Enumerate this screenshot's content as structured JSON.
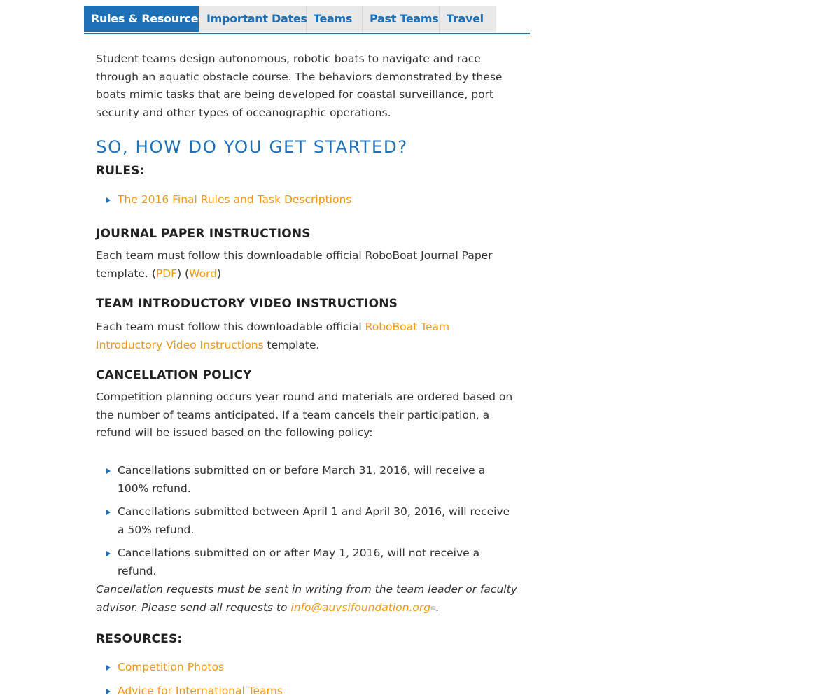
{
  "tabs": {
    "rules": "Rules & Resources",
    "dates": "Important Dates",
    "teams": "Teams",
    "past": "Past Teams",
    "travel": "Travel"
  },
  "intro": "Student teams design autonomous, robotic boats to navigate and race through an aquatic obstacle course. The behaviors demonstrated by these boats mimic tasks that are being developed for coastal surveillance, port security and other types of oceanographic operations.",
  "main_heading": "So, how do you get started?",
  "rules": {
    "heading": "Rules:",
    "link": "The 2016 Final Rules and Task Descriptions"
  },
  "journal": {
    "heading": "Journal Paper Instructions",
    "text_before": "Each team must follow this downloadable official RoboBoat Journal Paper template. (",
    "pdf_link": "PDF",
    "text_mid": ") (",
    "word_link": "Word",
    "text_after": ")"
  },
  "video": {
    "heading": "Team Introductory Video Instructions",
    "text_before": "Each team must follow this downloadable official ",
    "link": "RoboBoat Team Introductory Video Instructions",
    "text_after": " template."
  },
  "cancellation": {
    "heading": "Cancellation Policy",
    "text": "Competition planning occurs year round and materials are ordered based on the number of teams anticipated. If a team cancels their participation, a refund will be issued based on the following policy:",
    "items": [
      "Cancellations submitted on or before March 31, 2016, will receive a 100% refund.",
      "Cancellations submitted between April 1 and April 30, 2016, will receive a 50% refund.",
      "Cancellations submitted on or after May 1, 2016, will not receive a refund."
    ],
    "note_before": "Cancellation requests must be sent in writing from the team leader or faculty advisor. Please send all requests to ",
    "email": "info@auvsifoundation.org",
    "note_after": "."
  },
  "resources": {
    "heading": "Resources:",
    "links": [
      "Competition Photos",
      "Advice for International Teams"
    ]
  },
  "colors": {
    "accent_blue": "#1e70b7",
    "link_orange": "#f29712",
    "tab_inactive_bg": "#e9e9e9",
    "text": "#333333"
  },
  "icons": {
    "bullet": "caret-right-icon",
    "email": "envelope-icon"
  }
}
